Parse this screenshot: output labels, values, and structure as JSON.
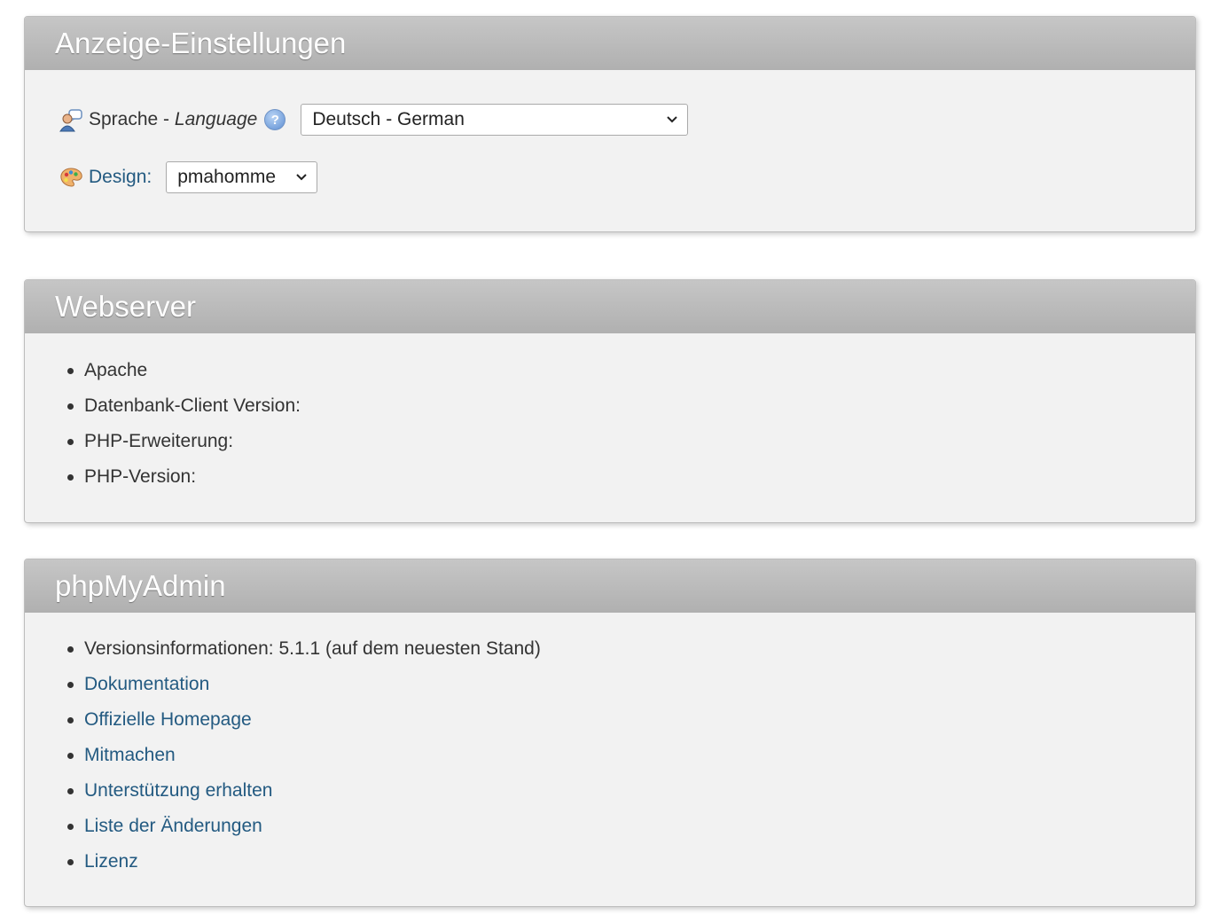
{
  "display_settings": {
    "title": "Anzeige-Einstellungen",
    "language_label_prefix": "Sprache - ",
    "language_label_italic": "Language",
    "help_icon_glyph": "?",
    "language_selected": "Deutsch - German",
    "design_label": "Design:",
    "design_selected": "pmahomme"
  },
  "webserver": {
    "title": "Webserver",
    "items": [
      "Apache",
      "Datenbank-Client Version:",
      "PHP-Erweiterung:",
      "PHP-Version:"
    ]
  },
  "phpmyadmin": {
    "title": "phpMyAdmin",
    "version_info": "Versionsinformationen: 5.1.1 (auf dem neuesten Stand)",
    "links": [
      "Dokumentation",
      "Offizielle Homepage",
      "Mitmachen",
      "Unterstützung erhalten",
      "Liste der Änderungen",
      "Lizenz"
    ]
  },
  "colors": {
    "link": "#235a81",
    "panel_header": "#b8b8b8",
    "panel_body": "#f2f2f2"
  }
}
